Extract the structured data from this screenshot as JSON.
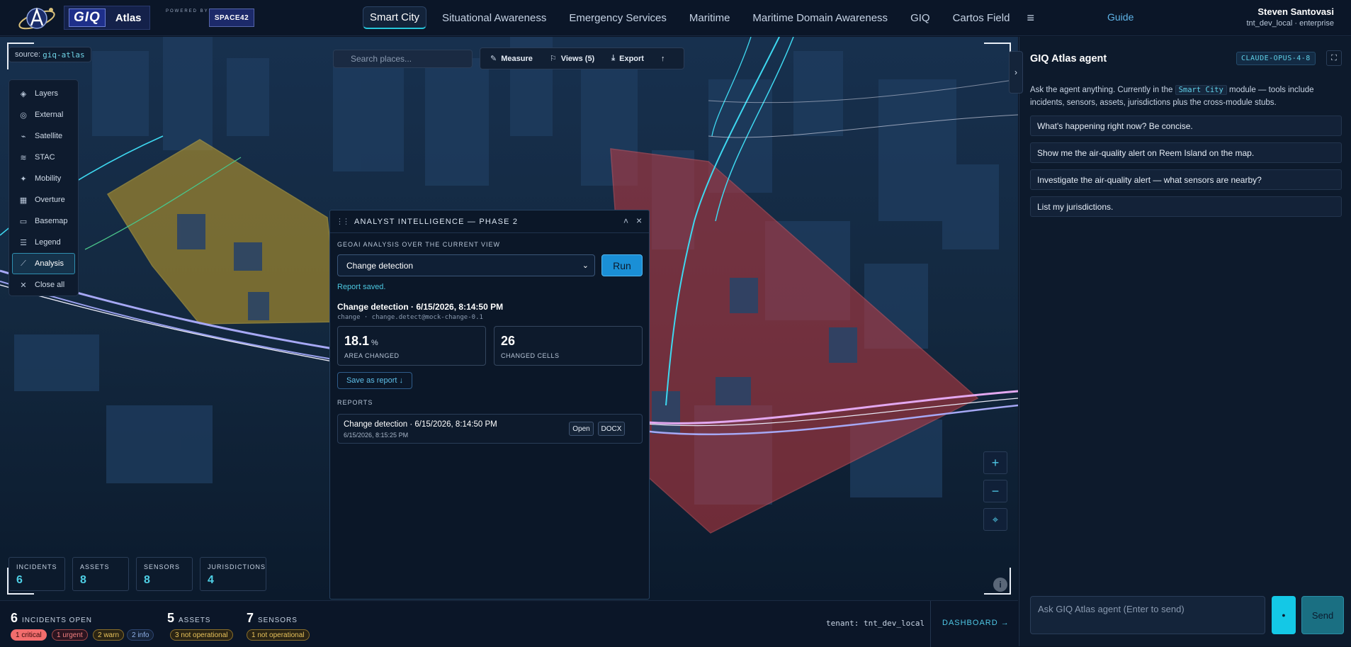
{
  "header": {
    "brand": {
      "mark": "GIQ",
      "name": "Atlas",
      "powered_by": "POWERED BY",
      "partner": "SPACE42"
    },
    "nav": [
      {
        "label": "Smart City",
        "active": true
      },
      {
        "label": "Situational Awareness"
      },
      {
        "label": "Emergency Services"
      },
      {
        "label": "Maritime"
      },
      {
        "label": "Maritime Domain Awareness"
      },
      {
        "label": "GIQ"
      },
      {
        "label": "Cartos Field"
      }
    ],
    "menu_icon": "≡",
    "guide": "Guide",
    "user": {
      "name": "Steven Santovasi",
      "sub": "tnt_dev_local · enterprise"
    }
  },
  "map": {
    "source_label": "source:",
    "source_value": "giq-atlas",
    "search_placeholder": "Search places...",
    "toolbar": {
      "measure": "Measure",
      "views": "Views (5)",
      "export": "Export",
      "more": "↑"
    },
    "layers_panel": [
      {
        "label": "Layers",
        "icon": "layers-icon"
      },
      {
        "label": "External",
        "icon": "globe-icon"
      },
      {
        "label": "Satellite",
        "icon": "satellite-icon"
      },
      {
        "label": "STAC",
        "icon": "stack-icon"
      },
      {
        "label": "Mobility",
        "icon": "mobility-icon"
      },
      {
        "label": "Overture",
        "icon": "grid-icon"
      },
      {
        "label": "Basemap",
        "icon": "map-icon"
      },
      {
        "label": "Legend",
        "icon": "legend-icon"
      },
      {
        "label": "Analysis",
        "icon": "analysis-icon",
        "active": true
      },
      {
        "label": "Close all",
        "icon": "close-icon"
      }
    ],
    "zoom": {
      "in": "+",
      "out": "−",
      "locate": "⌖"
    },
    "info": "i",
    "kpis": [
      {
        "label": "INCIDENTS",
        "value": "6"
      },
      {
        "label": "ASSETS",
        "value": "8"
      },
      {
        "label": "SENSORS",
        "value": "8"
      },
      {
        "label": "JURISDICTIONS",
        "value": "4"
      }
    ],
    "colors": {
      "polygon_yellow": "#c9a227",
      "polygon_red": "#c0393f",
      "road_cyan": "#3ed8f0",
      "road_pink": "#e3a8f0"
    }
  },
  "analyst": {
    "title": "ANALYST INTELLIGENCE — PHASE 2",
    "collapse": "˄",
    "close": "×",
    "subtitle": "GEOAI ANALYSIS OVER THE CURRENT VIEW",
    "select_value": "Change detection",
    "run": "Run",
    "saved": "Report saved.",
    "result_title": "Change detection · 6/15/2026, 8:14:50 PM",
    "result_sub": "change · change.detect@mock-change-0.1",
    "stats": [
      {
        "value": "18.1",
        "unit": "%",
        "label": "AREA CHANGED"
      },
      {
        "value": "26",
        "unit": "",
        "label": "CHANGED CELLS"
      }
    ],
    "save_report": "Save as report ↓",
    "reports_label": "REPORTS",
    "reports": [
      {
        "title": "Change detection · 6/15/2026, 8:14:50 PM",
        "date": "6/15/2026, 8:15:25 PM",
        "open": "Open",
        "docx": "DOCX"
      }
    ]
  },
  "bottombar": {
    "incidents": {
      "count": "6",
      "label": "INCIDENTS OPEN"
    },
    "incident_pills": [
      {
        "text": "1 critical",
        "color": "#f26d6d",
        "fill": true
      },
      {
        "text": "1 urgent",
        "color": "#f26d6d"
      },
      {
        "text": "2 warn",
        "color": "#e0b44a"
      },
      {
        "text": "2 info",
        "color": "#4b6fa8"
      }
    ],
    "assets": {
      "count": "5",
      "label": "ASSETS"
    },
    "asset_pill": {
      "text": "3 not operational",
      "color": "#e0b44a"
    },
    "sensors": {
      "count": "7",
      "label": "SENSORS"
    },
    "sensor_pill": {
      "text": "1 not operational",
      "color": "#e0b44a"
    },
    "tenant": "tenant: tnt_dev_local",
    "dashboard": "DASHBOARD →"
  },
  "agent": {
    "collapse": "›",
    "title": "GIQ Atlas agent",
    "model": "CLAUDE-OPUS-4-8",
    "expand": "⛶",
    "intro_pre": "Ask the agent anything. Currently in the",
    "intro_module": "Smart City",
    "intro_post": "module — tools include incidents, sensors, assets, jurisdictions plus the cross-module stubs.",
    "suggestions": [
      "What's happening right now? Be concise.",
      "Show me the air-quality alert on Reem Island on the map.",
      "Investigate the air-quality alert — what sensors are nearby?",
      "List my jurisdictions."
    ],
    "input_placeholder": "Ask GIQ Atlas agent (Enter to send)",
    "mic": "●",
    "send": "Send"
  }
}
